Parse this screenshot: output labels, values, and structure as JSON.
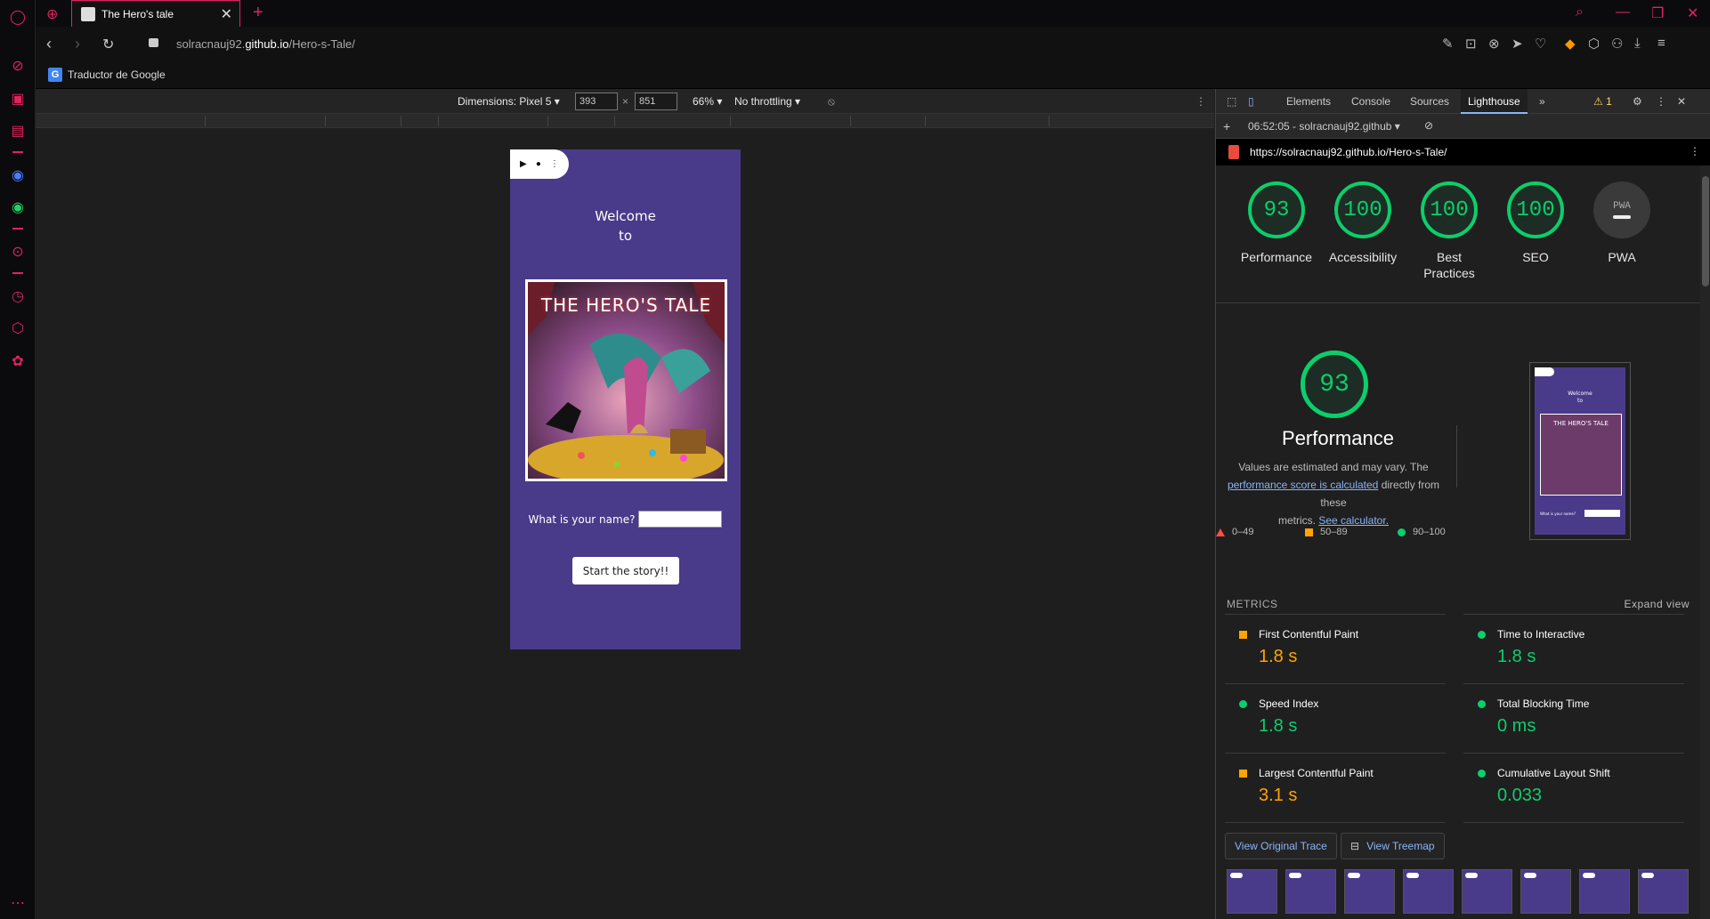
{
  "browser": {
    "tab_title": "The Hero's tale",
    "url_prefix": "solracnauj92.",
    "url_domain": "github.io",
    "url_path": "/Hero-s-Tale/",
    "bookmark": "Traductor de Google"
  },
  "device_toolbar": {
    "dimensions_label": "Dimensions: Pixel 5",
    "width": "393",
    "height": "851",
    "times": "×",
    "zoom": "66%",
    "throttling": "No throttling"
  },
  "app": {
    "pill_play": "▶",
    "pill_dot": "●",
    "pill_menu": "⋮",
    "welcome_line1": "Welcome",
    "welcome_line2": "to",
    "poster_title": "THE HERO'S TALE",
    "name_label": "What is your name?",
    "start_button": "Start the story!!"
  },
  "devtools": {
    "tabs": [
      "Elements",
      "Console",
      "Sources",
      "Lighthouse"
    ],
    "more": "»",
    "warnings": "⚠ 1",
    "report_time": "06:52:05 - solracnauj92.github",
    "report_url": "https://solracnauj92.github.io/Hero-s-Tale/",
    "gauges": [
      {
        "score": "93",
        "label": "Performance"
      },
      {
        "score": "100",
        "label": "Accessibility"
      },
      {
        "score": "100",
        "label": "Best Practices"
      },
      {
        "score": "100",
        "label": "SEO"
      },
      {
        "score": "PWA",
        "label": "PWA"
      }
    ],
    "perf_score": "93",
    "perf_title": "Performance",
    "perf_note_1": "Values are estimated and may vary. The",
    "perf_note_link1": "performance score is calculated",
    "perf_note_2": "directly from these",
    "perf_note_3": "metrics.",
    "perf_note_link2": "See calculator.",
    "legend": [
      "0–49",
      "50–89",
      "90–100"
    ],
    "metrics_title": "METRICS",
    "expand_view": "Expand view",
    "metrics": [
      {
        "name": "First Contentful Paint",
        "value": "1.8 s",
        "status": "orange"
      },
      {
        "name": "Time to Interactive",
        "value": "1.8 s",
        "status": "green"
      },
      {
        "name": "Speed Index",
        "value": "1.8 s",
        "status": "green"
      },
      {
        "name": "Total Blocking Time",
        "value": "0 ms",
        "status": "green"
      },
      {
        "name": "Largest Contentful Paint",
        "value": "3.1 s",
        "status": "orange"
      },
      {
        "name": "Cumulative Layout Shift",
        "value": "0.033",
        "status": "green"
      }
    ],
    "view_trace": "View Original Trace",
    "view_treemap": "View Treemap",
    "thumb_welcome": "Welcome",
    "thumb_to": "to",
    "thumb_title": "THE HERO'S TALE",
    "thumb_name_label": "What is your name?"
  },
  "colors": {
    "accent": "#e0245e",
    "app_bg": "#4a3a8a",
    "lh_green": "#0cce6b",
    "lh_orange": "#ffa400",
    "lh_red": "#ff4e42"
  }
}
